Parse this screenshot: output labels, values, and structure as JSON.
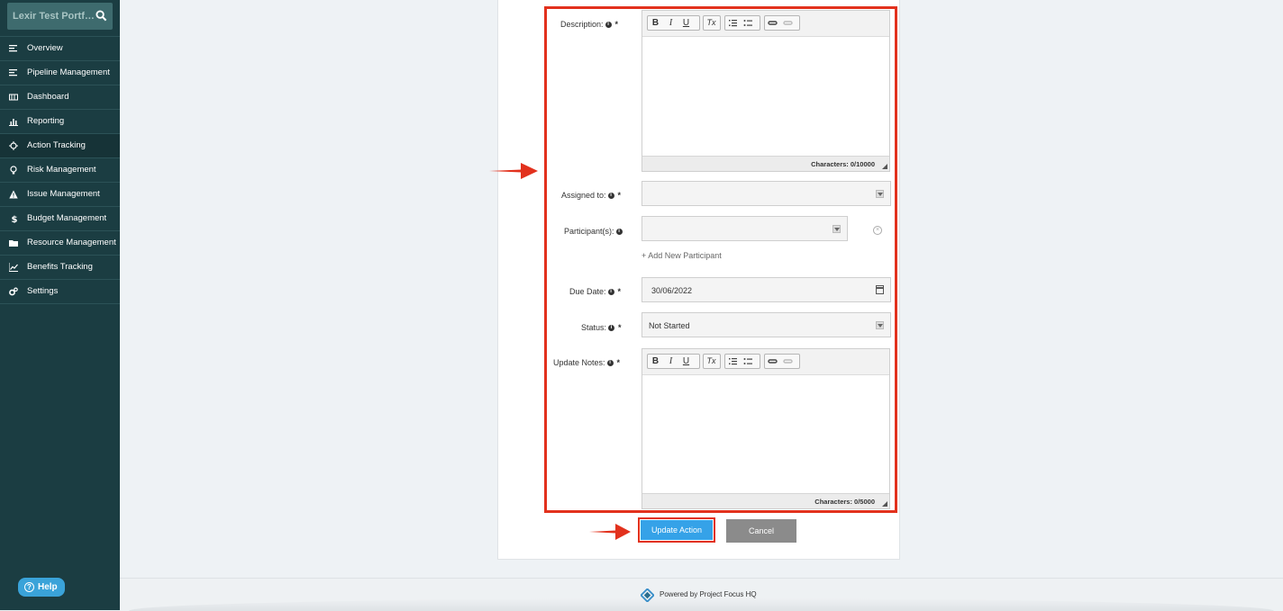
{
  "sidebar": {
    "search_text": "Lexir Test Portfo...",
    "items": [
      {
        "label": "Overview",
        "icon": "list-icon"
      },
      {
        "label": "Pipeline Management",
        "icon": "list-icon"
      },
      {
        "label": "Dashboard",
        "icon": "dashboard-icon"
      },
      {
        "label": "Reporting",
        "icon": "bar-chart-icon"
      },
      {
        "label": "Action Tracking",
        "icon": "crosshair-icon",
        "active": true
      },
      {
        "label": "Risk Management",
        "icon": "lightbulb-icon"
      },
      {
        "label": "Issue Management",
        "icon": "warning-icon"
      },
      {
        "label": "Budget Management",
        "icon": "dollar-icon"
      },
      {
        "label": "Resource Management",
        "icon": "folder-icon"
      },
      {
        "label": "Benefits Tracking",
        "icon": "line-chart-icon"
      },
      {
        "label": "Settings",
        "icon": "gears-icon"
      }
    ],
    "help_label": "Help"
  },
  "form": {
    "description": {
      "label": "Description:",
      "required": "*",
      "counter": "Characters: 0/10000"
    },
    "assigned_to": {
      "label": "Assigned to:",
      "required": "*",
      "value": ""
    },
    "participants": {
      "label": "Participant(s):",
      "value": "",
      "add_label": "+ Add New Participant"
    },
    "due_date": {
      "label": "Due Date:",
      "required": "*",
      "value": "30/06/2022"
    },
    "status": {
      "label": "Status:",
      "required": "*",
      "value": "Not Started"
    },
    "update_notes": {
      "label": "Update Notes:",
      "required": "*",
      "counter": "Characters: 0/5000"
    },
    "toolbar": {
      "bold": "B",
      "italic": "I",
      "underline": "U",
      "clear_format": "Tx"
    },
    "submit_label": "Update Action",
    "cancel_label": "Cancel"
  },
  "footer": {
    "text": "Powered by Project Focus HQ"
  },
  "colors": {
    "sidebar": "#1b3d42",
    "highlight": "#e2311d",
    "primary": "#35a2e8",
    "cancel": "#8b8b8b"
  }
}
